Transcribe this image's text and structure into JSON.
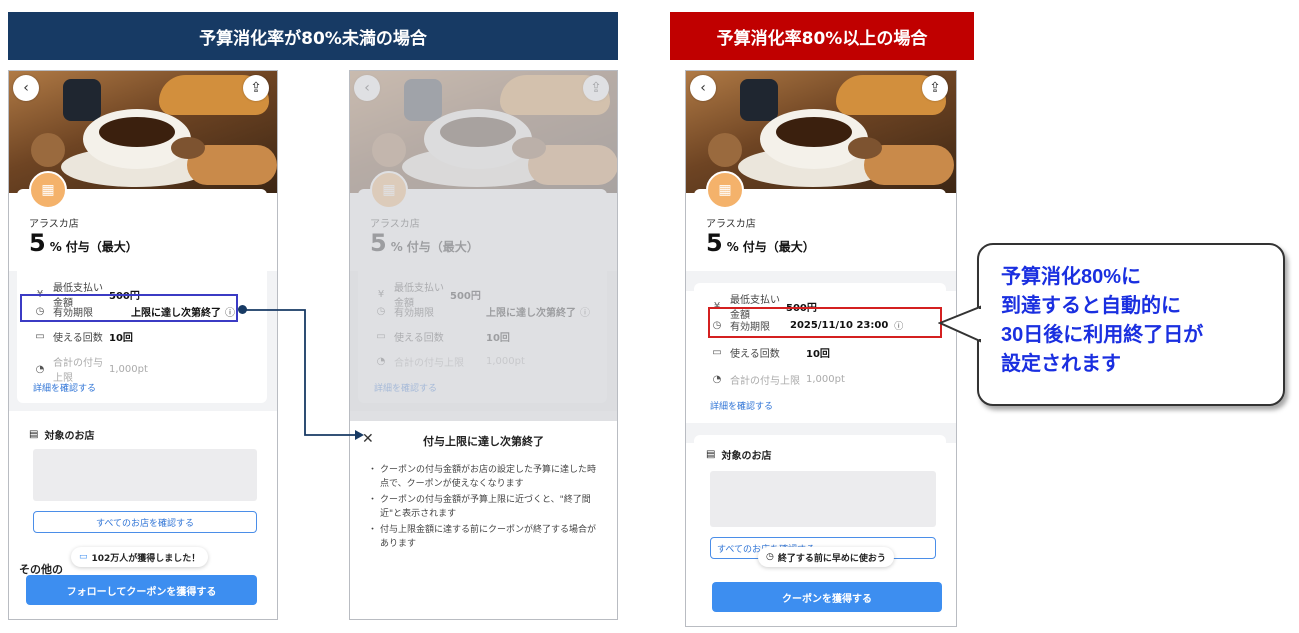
{
  "banners": {
    "left": "予算消化率が80%未満の場合",
    "right": "予算消化率80%以上の場合"
  },
  "icons": {
    "back": "chevron-left-icon",
    "share": "share-icon",
    "store": "store-icon",
    "yen": "yen-icon",
    "clock": "clock-icon",
    "ticket": "ticket-icon",
    "bag": "bag-icon",
    "info": "info-icon",
    "close": "close-icon"
  },
  "store": {
    "name": "アラスカ店",
    "rate_value": "5",
    "rate_unit": "%",
    "rate_label": "付与（最大）"
  },
  "info_rows": {
    "min_pay_label": "最低支払い金額",
    "min_pay_value": "500円",
    "validity_label": "有効期限",
    "validity_value_default": "上限に達し次第終了",
    "validity_value_dated": "2025/11/10  23:00",
    "uses_label": "使える回数",
    "uses_value": "10回",
    "total_cap_label": "合計の付与上限",
    "total_cap_value": "1,000pt"
  },
  "detail_link": "詳細を確認する",
  "target": {
    "title": "対象のお店",
    "button": "すべてのお店を確認する",
    "button_partial": "すべてのお店を確認する"
  },
  "other_heading_partial": "その他の",
  "toast_followers": "102万人が獲得しました！",
  "toast_hurry": "終了する前に早めに使おう",
  "follow_button": "フォローしてクーポンを獲得する",
  "get_button": "クーポンを獲得する",
  "sheet": {
    "title": "付与上限に達し次第終了",
    "items": [
      "クーポンの付与金額がお店の設定した予算に達した時点で、クーポンが使えなくなります",
      "クーポンの付与金額が予算上限に近づくと、\"終了間近\"と表示されます",
      "付与上限金額に達する前にクーポンが終了する場合があります"
    ]
  },
  "callout": "予算消化80%に\n到達すると自動的に\n30日後に利用終了日が\n設定されます",
  "colors": {
    "banner_left": "#173a64",
    "banner_right": "#c00000",
    "primary_button": "#3d8ef0",
    "link": "#2f74d6",
    "callout_text": "#1a2fe0",
    "highlight_blue": "#3b3bc4",
    "highlight_red": "#d42020"
  }
}
